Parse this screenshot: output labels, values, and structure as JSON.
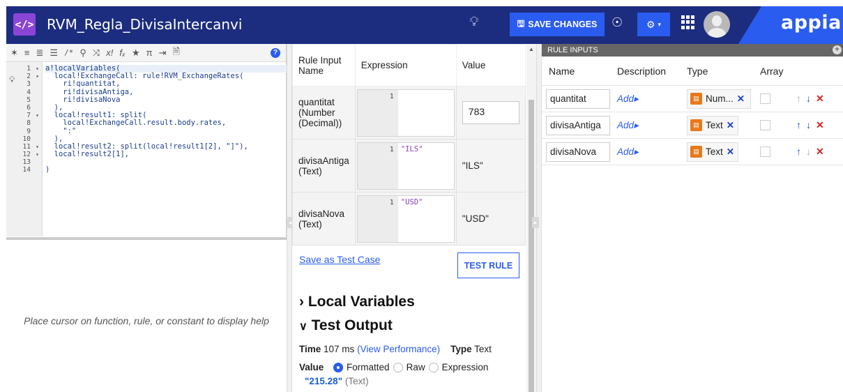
{
  "header": {
    "code_badge": "</>",
    "title": "RVM_Regla_DivisaIntercanvi",
    "save_label": "SAVE CHANGES",
    "brand": "appian"
  },
  "toolbar": {
    "icons": [
      "wand-icon",
      "indent-icon",
      "outdent-icon",
      "list-icon",
      "comment-icon",
      "search-icon",
      "shuffle-icon",
      "clear-icon",
      "function-icon",
      "star-icon",
      "pi-icon",
      "export-icon",
      "document-icon",
      "help-icon"
    ]
  },
  "editor": {
    "line_numbers": [
      "1",
      "2",
      "3",
      "4",
      "5",
      "6",
      "7",
      "8",
      "9",
      "10",
      "11",
      "12",
      "13",
      "14"
    ],
    "lines": [
      "a!localVariables(",
      "  local!ExchangeCall: rule!RVM_ExchangeRates(",
      "    ri!quantitat,",
      "    ri!divisaAntiga,",
      "    ri!divisaNova",
      "  ),",
      "  local!result1: split(",
      "    local!ExchangeCall.result.body.rates,",
      "    \":\"",
      "  ),",
      "  local!result2: split(local!result1[2], \"]\"),",
      "  local!result2[1],",
      "",
      ")"
    ],
    "help_text": "Place cursor on function, rule, or constant to display help"
  },
  "test_table": {
    "headers": [
      "Rule Input Name",
      "Expression",
      "Value"
    ],
    "rows": [
      {
        "name": "quantitat (Number (Decimal))",
        "expr_line": "1",
        "expr": "",
        "value": "783"
      },
      {
        "name": "divisaAntiga (Text)",
        "expr_line": "1",
        "expr": "\"ILS\"",
        "value": "\"ILS\""
      },
      {
        "name": "divisaNova (Text)",
        "expr_line": "1",
        "expr": "\"USD\"",
        "value": "\"USD\""
      }
    ]
  },
  "save_test_case": "Save as Test Case",
  "test_rule_label": "TEST RULE",
  "local_variables_title": "Local Variables",
  "test_output_title": "Test Output",
  "time_label": "Time",
  "time_value": "107 ms",
  "view_performance": "(View Performance)",
  "type_label": "Type",
  "type_value": "Text",
  "value_label": "Value",
  "formats": [
    "Formatted",
    "Raw",
    "Expression"
  ],
  "result_value": "\"215.28\"",
  "result_type": "(Text)",
  "rule_inputs": {
    "header": "RULE INPUTS",
    "columns": [
      "Name",
      "Description",
      "Type",
      "Array"
    ],
    "rows": [
      {
        "name": "quantitat",
        "desc": "Add",
        "type": "Num...",
        "up_enabled": false,
        "down_enabled": true
      },
      {
        "name": "divisaAntiga",
        "desc": "Add",
        "type": "Text",
        "up_enabled": true,
        "down_enabled": true
      },
      {
        "name": "divisaNova",
        "desc": "Add",
        "type": "Text",
        "up_enabled": true,
        "down_enabled": false
      }
    ]
  }
}
